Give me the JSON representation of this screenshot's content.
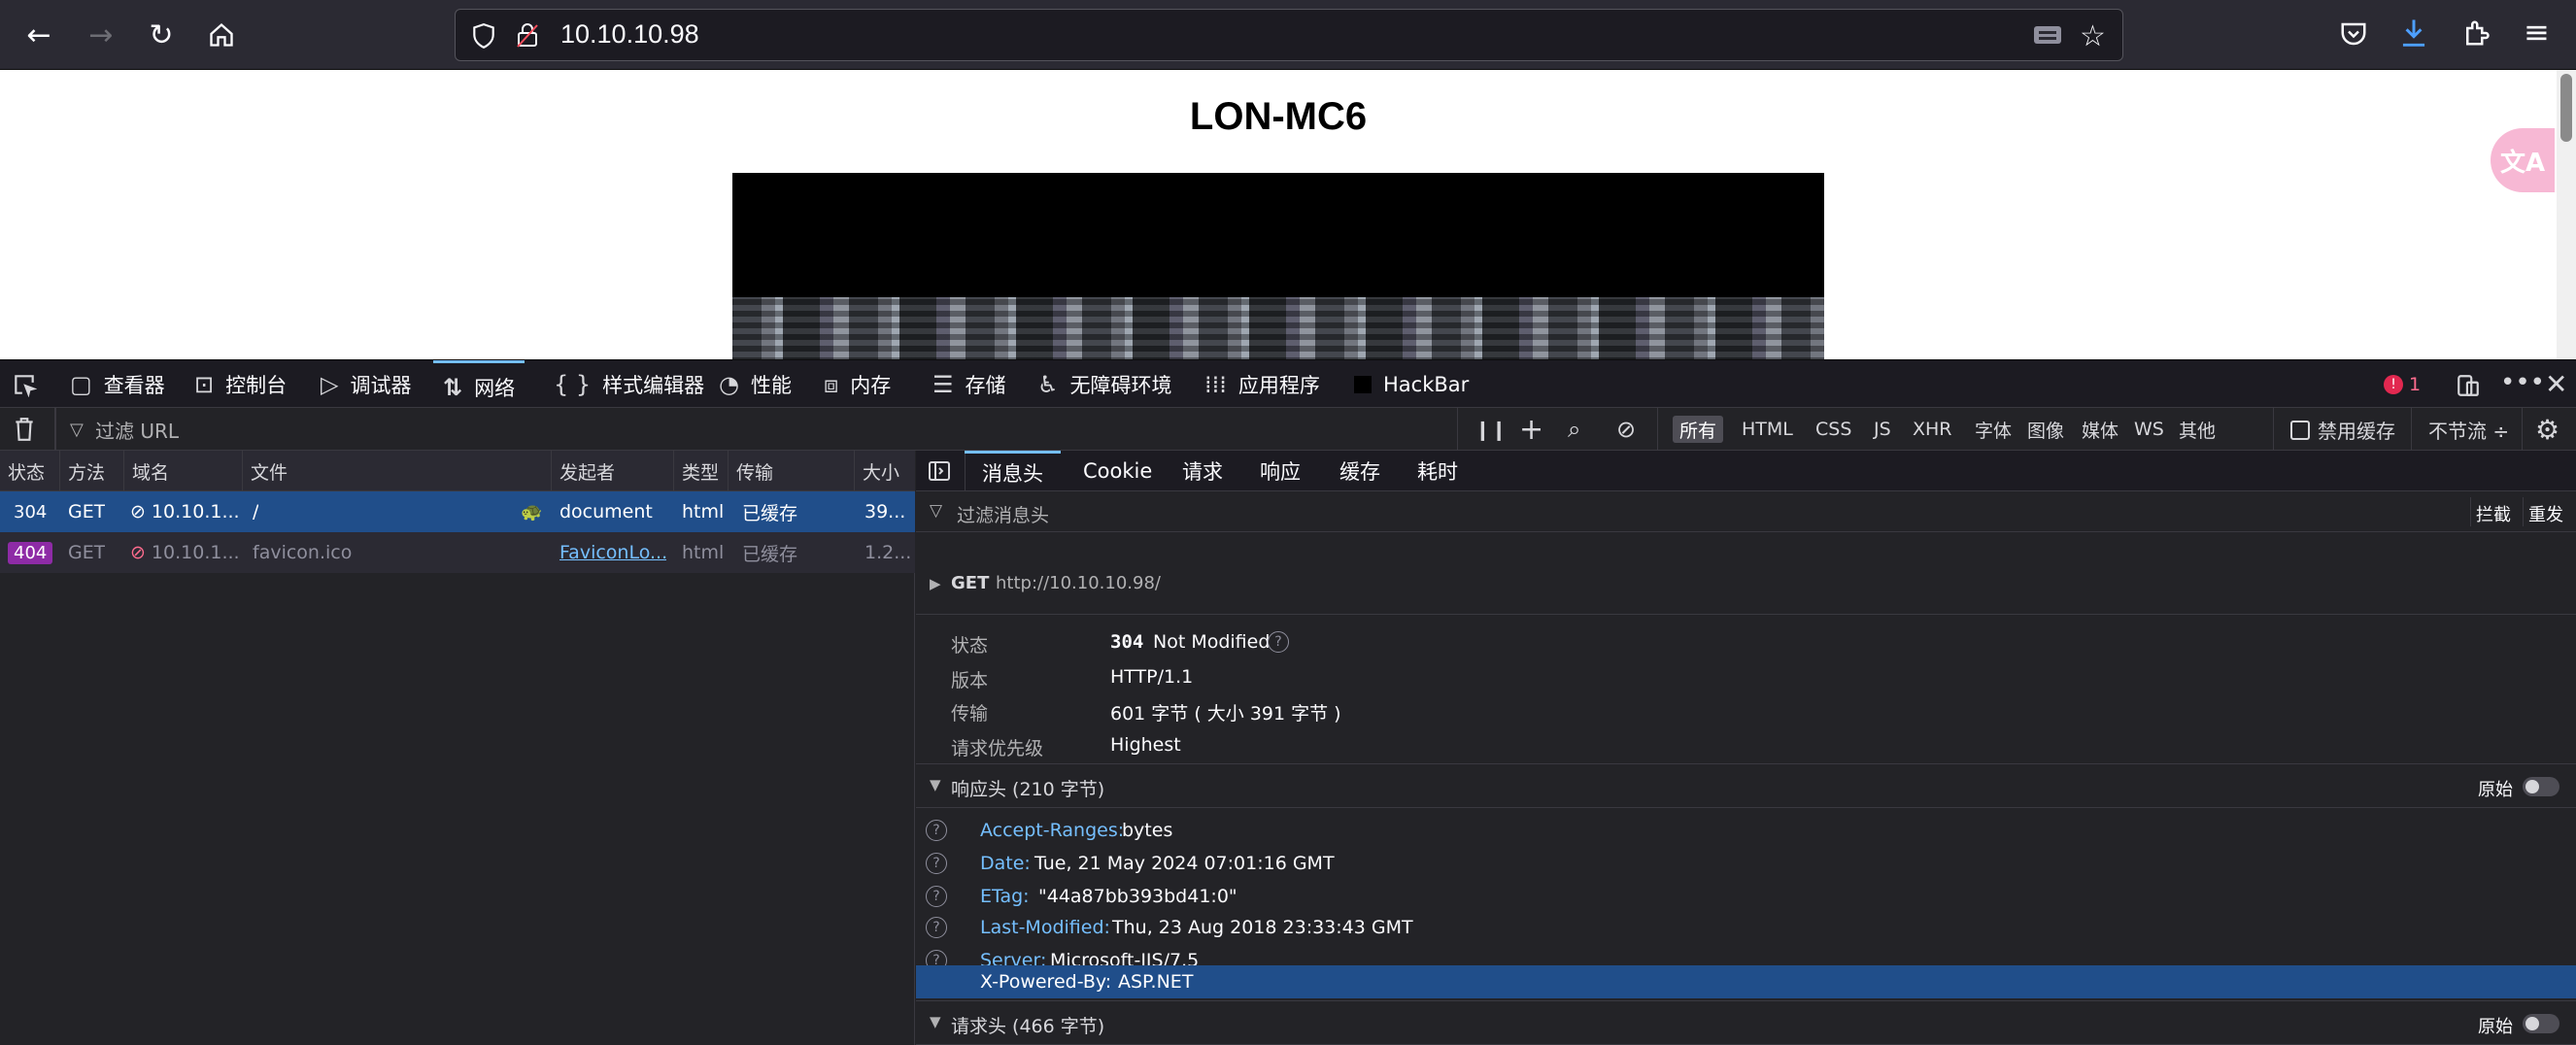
{
  "browser": {
    "url": "10.10.10.98"
  },
  "page": {
    "title": "LON-MC6"
  },
  "devtools": {
    "tabs": [
      "查看器",
      "控制台",
      "调试器",
      "网络",
      "样式编辑器",
      "性能",
      "内存",
      "存储",
      "无障碍环境",
      "应用程序",
      "HackBar"
    ],
    "error_count": "1",
    "filter_placeholder": "过滤 URL",
    "types": [
      "所有",
      "HTML",
      "CSS",
      "JS",
      "XHR",
      "字体",
      "图像",
      "媒体",
      "WS",
      "其他"
    ],
    "disable_cache": "禁用缓存",
    "throttle": "不节流 ÷"
  },
  "request_list": {
    "columns": [
      "状态",
      "方法",
      "域名",
      "文件",
      "发起者",
      "类型",
      "传输",
      "大小"
    ],
    "rows": [
      {
        "status": "304",
        "method": "GET",
        "domain": "10.10.1...",
        "file": "/",
        "initiator": "document",
        "type": "html",
        "transfer": "已缓存",
        "size": "39..."
      },
      {
        "status": "404",
        "method": "GET",
        "domain": "10.10.1...",
        "file": "favicon.ico",
        "initiator": "FaviconLo...",
        "type": "html",
        "transfer": "已缓存",
        "size": "1.2..."
      }
    ]
  },
  "details": {
    "tabs": [
      "消息头",
      "Cookie",
      "请求",
      "响应",
      "缓存",
      "耗时"
    ],
    "filter_placeholder": "过滤消息头",
    "block": "拦截",
    "resend": "重发",
    "request_line": "GET",
    "request_url": "http://10.10.10.98/",
    "summary": [
      {
        "label": "状态",
        "value_code": "304",
        "value": "Not Modified"
      },
      {
        "label": "版本",
        "value": "HTTP/1.1"
      },
      {
        "label": "传输",
        "value": "601 字节 ( 大小 391 字节 )"
      },
      {
        "label": "请求优先级",
        "value": "Highest"
      }
    ],
    "response_headers_title": "响应头 (210 字节)",
    "raw": "原始",
    "response_headers": [
      {
        "key": "Accept-Ranges:",
        "value": "bytes"
      },
      {
        "key": "Date:",
        "value": "Tue, 21 May 2024 07:01:16 GMT"
      },
      {
        "key": "ETag:",
        "value": "\"44a87bb393bd41:0\""
      },
      {
        "key": "Last-Modified:",
        "value": "Thu, 23 Aug 2018 23:33:43 GMT"
      },
      {
        "key": "Server:",
        "value": "Microsoft-IIS/7.5"
      },
      {
        "key": "X-Powered-By:",
        "value": "ASP.NET"
      }
    ],
    "request_headers_title": "请求头 (466 字节)"
  },
  "colors": {
    "accent": "#75bfff",
    "selected_row": "#204e8a",
    "badge_404": "#8e2ba6"
  }
}
